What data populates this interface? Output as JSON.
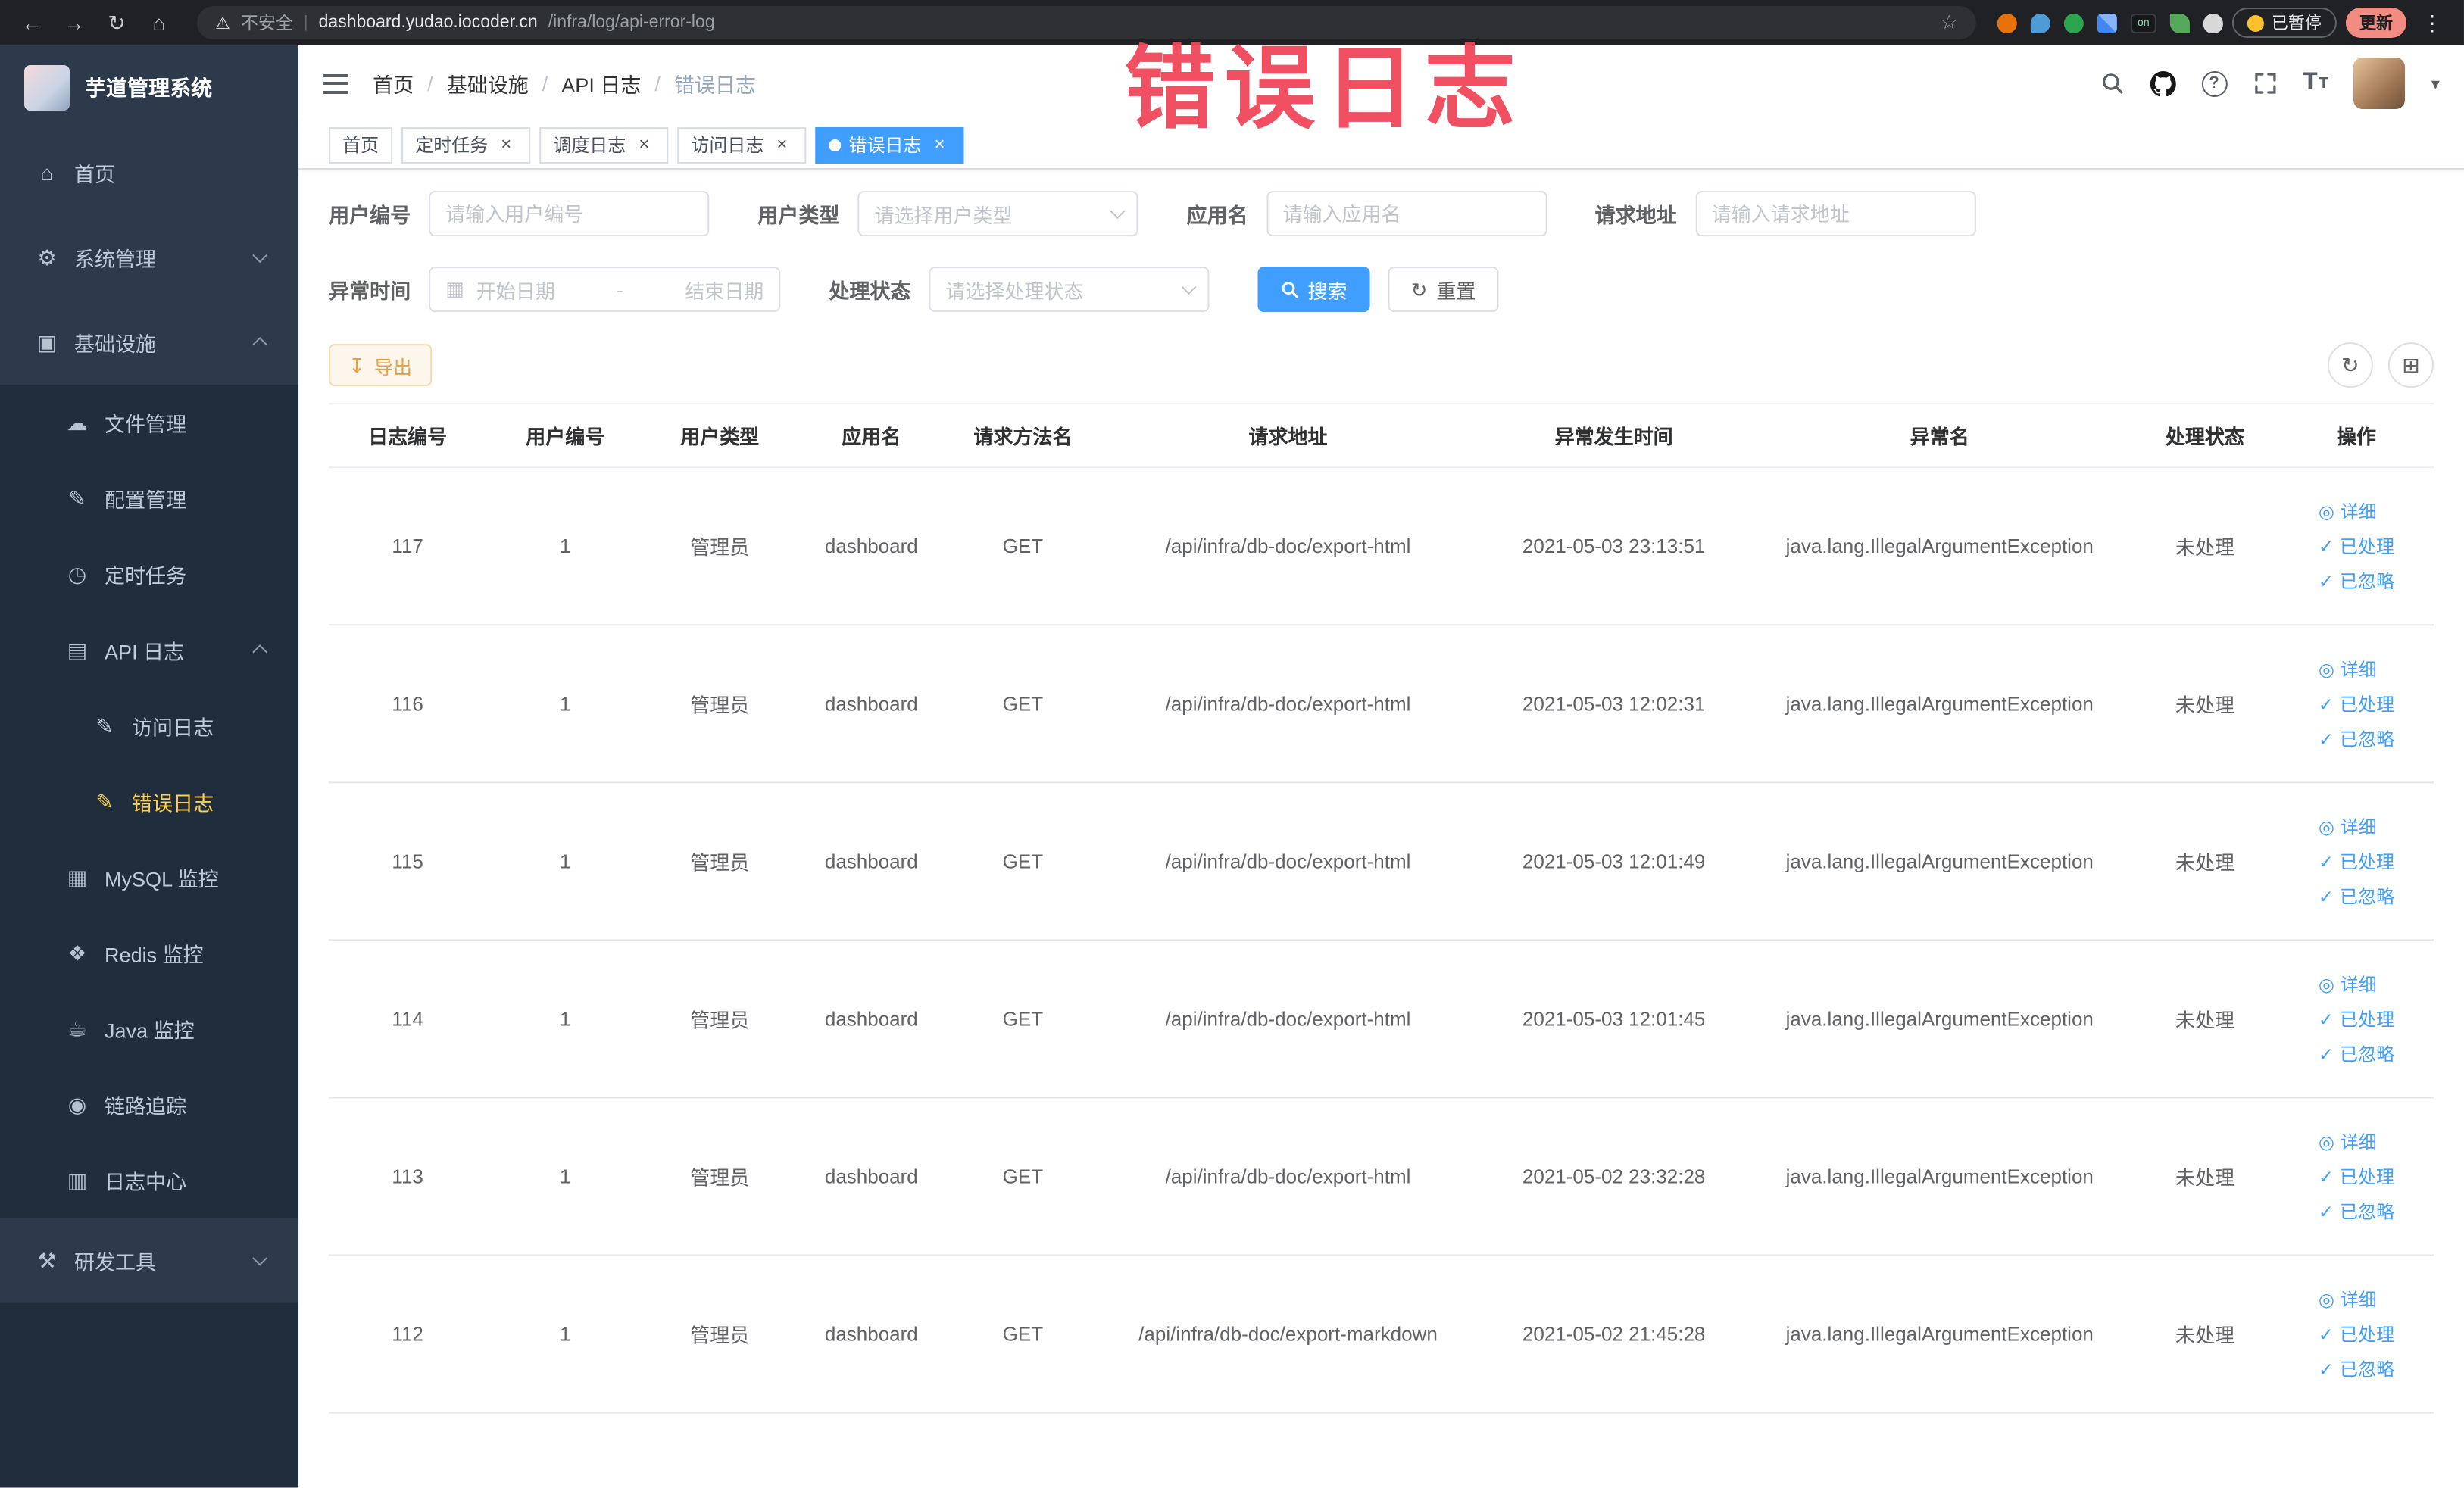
{
  "watermark": "错误日志",
  "browser": {
    "security_label": "不安全",
    "url_host": "dashboard.yudao.iocoder.cn",
    "url_path": "/infra/log/api-error-log",
    "paused_label": "已暂停",
    "update_label": "更新",
    "extension_on_text": "on"
  },
  "sidebar": {
    "logo_title": "芋道管理系统",
    "items": [
      {
        "label": "首页",
        "icon": "home-icon",
        "level": 0
      },
      {
        "label": "系统管理",
        "icon": "gear-icon",
        "level": 0,
        "chevron": "down"
      },
      {
        "label": "基础设施",
        "icon": "infrastructure-icon",
        "level": 0,
        "chevron": "up"
      },
      {
        "label": "文件管理",
        "icon": "file-icon",
        "level": 1
      },
      {
        "label": "配置管理",
        "icon": "config-icon",
        "level": 1
      },
      {
        "label": "定时任务",
        "icon": "timer-icon",
        "level": 1
      },
      {
        "label": "API 日志",
        "icon": "api-log-icon",
        "level": 1,
        "chevron": "up"
      },
      {
        "label": "访问日志",
        "icon": "doc-icon",
        "level": 2
      },
      {
        "label": "错误日志",
        "icon": "doc-icon",
        "level": 2,
        "active": true
      },
      {
        "label": "MySQL 监控",
        "icon": "mysql-icon",
        "level": 1
      },
      {
        "label": "Redis 监控",
        "icon": "redis-icon",
        "level": 1
      },
      {
        "label": "Java 监控",
        "icon": "java-icon",
        "level": 1
      },
      {
        "label": "链路追踪",
        "icon": "trace-icon",
        "level": 1
      },
      {
        "label": "日志中心",
        "icon": "log-center-icon",
        "level": 1
      },
      {
        "label": "研发工具",
        "icon": "tools-icon",
        "level": 0,
        "chevron": "down"
      }
    ]
  },
  "header": {
    "breadcrumb": [
      "首页",
      "基础设施",
      "API 日志",
      "错误日志"
    ]
  },
  "tabs": [
    {
      "label": "首页",
      "closable": false,
      "active": false
    },
    {
      "label": "定时任务",
      "closable": true,
      "active": false
    },
    {
      "label": "调度日志",
      "closable": true,
      "active": false
    },
    {
      "label": "访问日志",
      "closable": true,
      "active": false
    },
    {
      "label": "错误日志",
      "closable": true,
      "active": true
    }
  ],
  "filters": {
    "user_id": {
      "label": "用户编号",
      "placeholder": "请输入用户编号",
      "value": ""
    },
    "user_type": {
      "label": "用户类型",
      "placeholder": "请选择用户类型"
    },
    "app_name": {
      "label": "应用名",
      "placeholder": "请输入应用名",
      "value": ""
    },
    "request_url": {
      "label": "请求地址",
      "placeholder": "请输入请求地址",
      "value": ""
    },
    "exception_time": {
      "label": "异常时间",
      "start_placeholder": "开始日期",
      "separator": "-",
      "end_placeholder": "结束日期"
    },
    "process_status": {
      "label": "处理状态",
      "placeholder": "请选择处理状态"
    },
    "search_button": "搜索",
    "reset_button": "重置"
  },
  "toolbar": {
    "export_button": "导出"
  },
  "table": {
    "columns": [
      "日志编号",
      "用户编号",
      "用户类型",
      "应用名",
      "请求方法名",
      "请求地址",
      "异常发生时间",
      "异常名",
      "处理状态",
      "操作"
    ],
    "rows": [
      {
        "log_id": "117",
        "user_id": "1",
        "user_type": "管理员",
        "app_name": "dashboard",
        "method": "GET",
        "request_url": "/api/infra/db-doc/export-html",
        "time": "2021-05-03 23:13:51",
        "exception": "java.lang.IllegalArgumentException",
        "status": "未处理"
      },
      {
        "log_id": "116",
        "user_id": "1",
        "user_type": "管理员",
        "app_name": "dashboard",
        "method": "GET",
        "request_url": "/api/infra/db-doc/export-html",
        "time": "2021-05-03 12:02:31",
        "exception": "java.lang.IllegalArgumentException",
        "status": "未处理"
      },
      {
        "log_id": "115",
        "user_id": "1",
        "user_type": "管理员",
        "app_name": "dashboard",
        "method": "GET",
        "request_url": "/api/infra/db-doc/export-html",
        "time": "2021-05-03 12:01:49",
        "exception": "java.lang.IllegalArgumentException",
        "status": "未处理"
      },
      {
        "log_id": "114",
        "user_id": "1",
        "user_type": "管理员",
        "app_name": "dashboard",
        "method": "GET",
        "request_url": "/api/infra/db-doc/export-html",
        "time": "2021-05-03 12:01:45",
        "exception": "java.lang.IllegalArgumentException",
        "status": "未处理"
      },
      {
        "log_id": "113",
        "user_id": "1",
        "user_type": "管理员",
        "app_name": "dashboard",
        "method": "GET",
        "request_url": "/api/infra/db-doc/export-html",
        "time": "2021-05-02 23:32:28",
        "exception": "java.lang.IllegalArgumentException",
        "status": "未处理"
      },
      {
        "log_id": "112",
        "user_id": "1",
        "user_type": "管理员",
        "app_name": "dashboard",
        "method": "GET",
        "request_url": "/api/infra/db-doc/export-markdown",
        "time": "2021-05-02 21:45:28",
        "exception": "java.lang.IllegalArgumentException",
        "status": "未处理"
      }
    ],
    "actions": [
      {
        "name": "detail",
        "label": "详细",
        "icon": "eye-icon"
      },
      {
        "name": "processed",
        "label": "已处理",
        "icon": "check-icon"
      },
      {
        "name": "ignored",
        "label": "已忽略",
        "icon": "check-icon"
      }
    ]
  },
  "colors": {
    "primary": "#409eff",
    "sidebar_bg": "#2d3a4b",
    "submenu_bg": "#1f2d3d",
    "sidebar_active_text": "#ffd04b",
    "watermark_red": "#f0475a",
    "warning": "#e6a23c",
    "chrome_bg": "#202124"
  },
  "icons": {
    "back-icon": "←",
    "forward-icon": "→",
    "reload-icon": "↻",
    "browser-home-icon": "⌂",
    "warning-icon": "⚠",
    "star-icon": "☆",
    "more-vertical-icon": "⋮",
    "divider-icon": "|",
    "help-icon": "?",
    "caret-down-icon": "▾",
    "export-icon": "↧",
    "refresh-icon": "↻",
    "column-settings-icon": "⊞",
    "reset-icon": "↻",
    "calendar-icon": "▦",
    "eye-icon": "◎",
    "check-icon": "✓",
    "close-icon": "×",
    "home-icon": "⌂",
    "gear-icon": "⚙",
    "infrastructure-icon": "▣",
    "file-icon": "☁",
    "config-icon": "✎",
    "timer-icon": "◷",
    "api-log-icon": "▤",
    "doc-icon": "✎",
    "mysql-icon": "▦",
    "redis-icon": "❖",
    "java-icon": "☕",
    "trace-icon": "◉",
    "log-center-icon": "▥",
    "tools-icon": "⚒"
  }
}
